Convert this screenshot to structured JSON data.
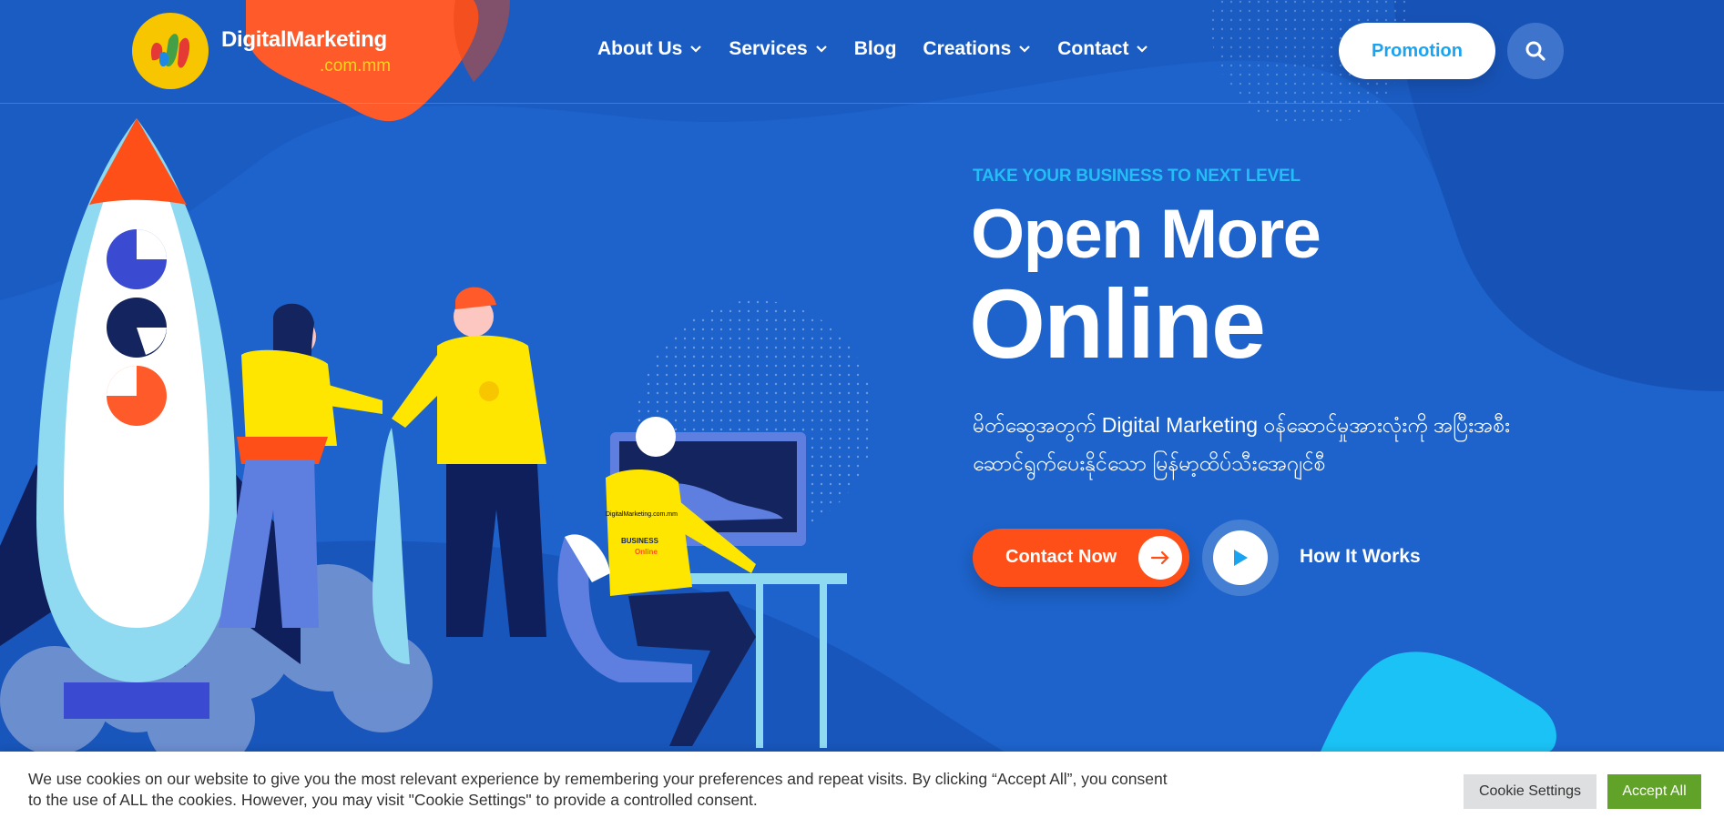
{
  "brand": {
    "name": "DigitalMarketing",
    "domain": ".com.mm"
  },
  "nav": {
    "items": [
      {
        "label": "About Us",
        "dropdown": true
      },
      {
        "label": "Services",
        "dropdown": true
      },
      {
        "label": "Blog",
        "dropdown": false
      },
      {
        "label": "Creations",
        "dropdown": true
      },
      {
        "label": "Contact",
        "dropdown": true
      }
    ],
    "promo_label": "Promotion",
    "search_icon": "search-icon"
  },
  "hero": {
    "eyebrow": "TAKE YOUR BUSINESS TO NEXT LEVEL",
    "title_line1": "Open More",
    "title_line2": "Online",
    "description": "မိတ်ဆွေအတွက် Digital Marketing ဝန်ဆောင်မှုအားလုံးကို အပြီးအစီး ဆောင်ရွက်ပေးနိုင်သော မြန်မာ့ထိပ်သီးအေဂျင်စီ",
    "contact_label": "Contact Now",
    "how_label": "How It Works"
  },
  "illustration": {
    "shirt_text": "DigitalMarketing.com.mm",
    "badge_text": "BUSINESS",
    "badge_sub": "Online"
  },
  "cookie": {
    "text": "We use cookies on our website to give you the most relevant experience by remembering your preferences and repeat visits. By clicking “Accept All”, you consent to the use of ALL the cookies. However, you may visit \"Cookie Settings\" to provide a controlled consent.",
    "settings_label": "Cookie Settings",
    "accept_label": "Accept All"
  },
  "colors": {
    "background": "#1a5cc2",
    "accent_orange": "#ff4f18",
    "accent_cyan": "#25bdf5",
    "accent_yellow": "#ffd21f",
    "accept_green": "#61a229"
  }
}
